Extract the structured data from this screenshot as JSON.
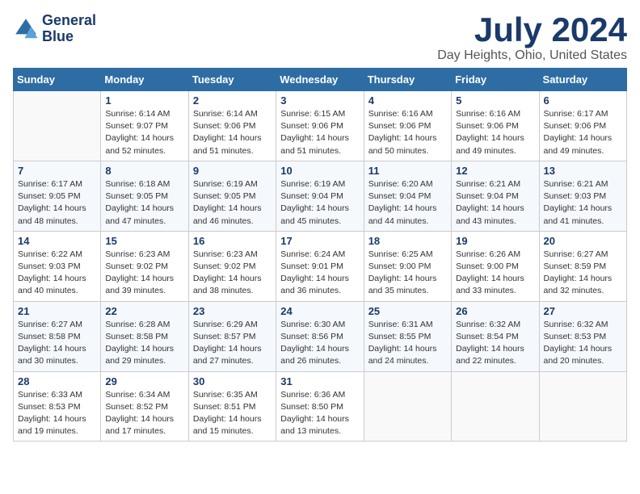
{
  "logo": {
    "line1": "General",
    "line2": "Blue"
  },
  "title": "July 2024",
  "subtitle": "Day Heights, Ohio, United States",
  "weekdays": [
    "Sunday",
    "Monday",
    "Tuesday",
    "Wednesday",
    "Thursday",
    "Friday",
    "Saturday"
  ],
  "weeks": [
    [
      {
        "day": "",
        "info": ""
      },
      {
        "day": "1",
        "info": "Sunrise: 6:14 AM\nSunset: 9:07 PM\nDaylight: 14 hours\nand 52 minutes."
      },
      {
        "day": "2",
        "info": "Sunrise: 6:14 AM\nSunset: 9:06 PM\nDaylight: 14 hours\nand 51 minutes."
      },
      {
        "day": "3",
        "info": "Sunrise: 6:15 AM\nSunset: 9:06 PM\nDaylight: 14 hours\nand 51 minutes."
      },
      {
        "day": "4",
        "info": "Sunrise: 6:16 AM\nSunset: 9:06 PM\nDaylight: 14 hours\nand 50 minutes."
      },
      {
        "day": "5",
        "info": "Sunrise: 6:16 AM\nSunset: 9:06 PM\nDaylight: 14 hours\nand 49 minutes."
      },
      {
        "day": "6",
        "info": "Sunrise: 6:17 AM\nSunset: 9:06 PM\nDaylight: 14 hours\nand 49 minutes."
      }
    ],
    [
      {
        "day": "7",
        "info": "Sunrise: 6:17 AM\nSunset: 9:05 PM\nDaylight: 14 hours\nand 48 minutes."
      },
      {
        "day": "8",
        "info": "Sunrise: 6:18 AM\nSunset: 9:05 PM\nDaylight: 14 hours\nand 47 minutes."
      },
      {
        "day": "9",
        "info": "Sunrise: 6:19 AM\nSunset: 9:05 PM\nDaylight: 14 hours\nand 46 minutes."
      },
      {
        "day": "10",
        "info": "Sunrise: 6:19 AM\nSunset: 9:04 PM\nDaylight: 14 hours\nand 45 minutes."
      },
      {
        "day": "11",
        "info": "Sunrise: 6:20 AM\nSunset: 9:04 PM\nDaylight: 14 hours\nand 44 minutes."
      },
      {
        "day": "12",
        "info": "Sunrise: 6:21 AM\nSunset: 9:04 PM\nDaylight: 14 hours\nand 43 minutes."
      },
      {
        "day": "13",
        "info": "Sunrise: 6:21 AM\nSunset: 9:03 PM\nDaylight: 14 hours\nand 41 minutes."
      }
    ],
    [
      {
        "day": "14",
        "info": "Sunrise: 6:22 AM\nSunset: 9:03 PM\nDaylight: 14 hours\nand 40 minutes."
      },
      {
        "day": "15",
        "info": "Sunrise: 6:23 AM\nSunset: 9:02 PM\nDaylight: 14 hours\nand 39 minutes."
      },
      {
        "day": "16",
        "info": "Sunrise: 6:23 AM\nSunset: 9:02 PM\nDaylight: 14 hours\nand 38 minutes."
      },
      {
        "day": "17",
        "info": "Sunrise: 6:24 AM\nSunset: 9:01 PM\nDaylight: 14 hours\nand 36 minutes."
      },
      {
        "day": "18",
        "info": "Sunrise: 6:25 AM\nSunset: 9:00 PM\nDaylight: 14 hours\nand 35 minutes."
      },
      {
        "day": "19",
        "info": "Sunrise: 6:26 AM\nSunset: 9:00 PM\nDaylight: 14 hours\nand 33 minutes."
      },
      {
        "day": "20",
        "info": "Sunrise: 6:27 AM\nSunset: 8:59 PM\nDaylight: 14 hours\nand 32 minutes."
      }
    ],
    [
      {
        "day": "21",
        "info": "Sunrise: 6:27 AM\nSunset: 8:58 PM\nDaylight: 14 hours\nand 30 minutes."
      },
      {
        "day": "22",
        "info": "Sunrise: 6:28 AM\nSunset: 8:58 PM\nDaylight: 14 hours\nand 29 minutes."
      },
      {
        "day": "23",
        "info": "Sunrise: 6:29 AM\nSunset: 8:57 PM\nDaylight: 14 hours\nand 27 minutes."
      },
      {
        "day": "24",
        "info": "Sunrise: 6:30 AM\nSunset: 8:56 PM\nDaylight: 14 hours\nand 26 minutes."
      },
      {
        "day": "25",
        "info": "Sunrise: 6:31 AM\nSunset: 8:55 PM\nDaylight: 14 hours\nand 24 minutes."
      },
      {
        "day": "26",
        "info": "Sunrise: 6:32 AM\nSunset: 8:54 PM\nDaylight: 14 hours\nand 22 minutes."
      },
      {
        "day": "27",
        "info": "Sunrise: 6:32 AM\nSunset: 8:53 PM\nDaylight: 14 hours\nand 20 minutes."
      }
    ],
    [
      {
        "day": "28",
        "info": "Sunrise: 6:33 AM\nSunset: 8:53 PM\nDaylight: 14 hours\nand 19 minutes."
      },
      {
        "day": "29",
        "info": "Sunrise: 6:34 AM\nSunset: 8:52 PM\nDaylight: 14 hours\nand 17 minutes."
      },
      {
        "day": "30",
        "info": "Sunrise: 6:35 AM\nSunset: 8:51 PM\nDaylight: 14 hours\nand 15 minutes."
      },
      {
        "day": "31",
        "info": "Sunrise: 6:36 AM\nSunset: 8:50 PM\nDaylight: 14 hours\nand 13 minutes."
      },
      {
        "day": "",
        "info": ""
      },
      {
        "day": "",
        "info": ""
      },
      {
        "day": "",
        "info": ""
      }
    ]
  ],
  "colors": {
    "header_bg": "#2e6da4",
    "logo_color": "#1a3a6b",
    "title_color": "#1a3a6b"
  }
}
